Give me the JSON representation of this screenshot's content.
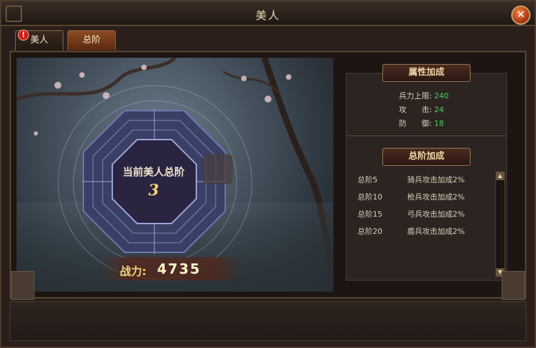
{
  "window": {
    "title": "美人"
  },
  "tabs": [
    {
      "label": "美人",
      "alert": "!"
    },
    {
      "label": "总阶"
    }
  ],
  "scene": {
    "center_label": "当前美人总阶",
    "center_value": "3",
    "power_label": "战力:",
    "power_value": "4735"
  },
  "attributes": {
    "heading": "属性加成",
    "items": [
      {
        "label": "兵力上限:",
        "value": "240"
      },
      {
        "label": "攻　　击:",
        "value": "24"
      },
      {
        "label": "防　　御:",
        "value": "18"
      }
    ]
  },
  "bonus": {
    "heading": "总阶加成",
    "items": [
      {
        "tier": "总阶5",
        "desc": "骑兵攻击加成2%"
      },
      {
        "tier": "总阶10",
        "desc": "枪兵攻击加成2%"
      },
      {
        "tier": "总阶15",
        "desc": "弓兵攻击加成2%"
      },
      {
        "tier": "总阶20",
        "desc": "盾兵攻击加成2%"
      }
    ]
  },
  "icons": {
    "close": "close-icon",
    "alert": "alert-icon",
    "scroll_up": "chevron-up-icon",
    "scroll_down": "chevron-down-icon"
  },
  "colors": {
    "value_green": "#4cd060",
    "gold": "#f6d872",
    "close_orange": "#e8642a"
  }
}
